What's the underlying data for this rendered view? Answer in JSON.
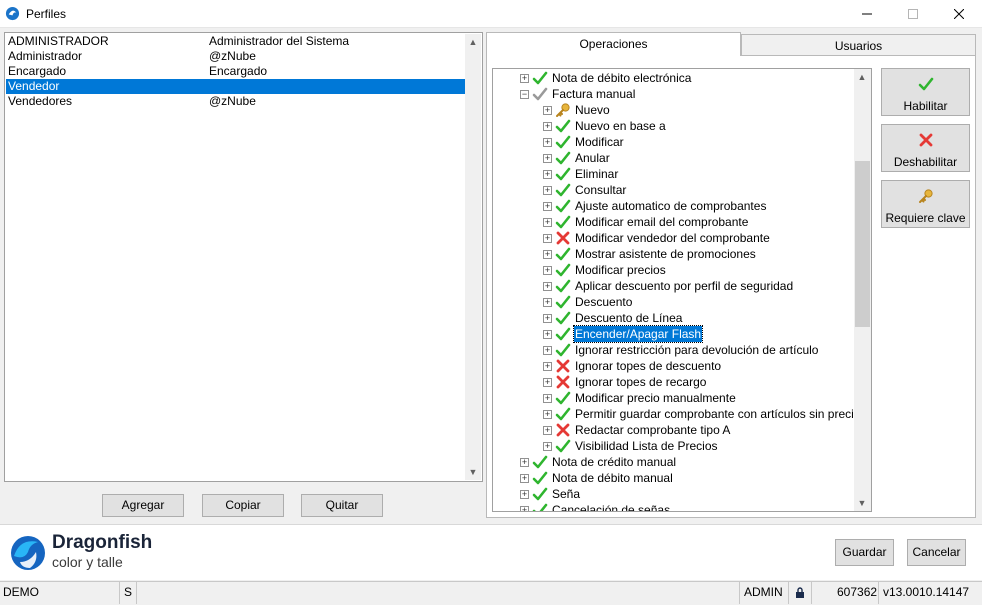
{
  "window": {
    "title": "Perfiles",
    "minimize_icon": "minimize-icon",
    "maximize_icon": "maximize-icon",
    "close_icon": "close-icon"
  },
  "profiles": [
    {
      "name": "ADMINISTRADOR",
      "description": "Administrador del Sistema"
    },
    {
      "name": "Administrador",
      "description": "@zNube"
    },
    {
      "name": "Encargado",
      "description": "Encargado"
    },
    {
      "name": "Vendedor",
      "description": "",
      "selected": true
    },
    {
      "name": "Vendedores",
      "description": "@zNube"
    }
  ],
  "left_buttons": {
    "agregar": "Agregar",
    "copiar": "Copiar",
    "quitar": "Quitar"
  },
  "tabs": [
    {
      "label": "Operaciones",
      "active": true
    },
    {
      "label": "Usuarios",
      "active": false
    }
  ],
  "tree": [
    {
      "label": "Nota de débito electrónica",
      "level": 0,
      "status": "check"
    },
    {
      "label": "Factura manual",
      "level": 0,
      "status": "partial",
      "expanded": true
    },
    {
      "label": "Nuevo",
      "level": 1,
      "status": "key"
    },
    {
      "label": "Nuevo en base a",
      "level": 1,
      "status": "check"
    },
    {
      "label": "Modificar",
      "level": 1,
      "status": "check"
    },
    {
      "label": "Anular",
      "level": 1,
      "status": "check"
    },
    {
      "label": "Eliminar",
      "level": 1,
      "status": "check"
    },
    {
      "label": "Consultar",
      "level": 1,
      "status": "check"
    },
    {
      "label": "Ajuste automatico de comprobantes",
      "level": 1,
      "status": "check"
    },
    {
      "label": "Modificar email del comprobante",
      "level": 1,
      "status": "check"
    },
    {
      "label": "Modificar vendedor del comprobante",
      "level": 1,
      "status": "cross"
    },
    {
      "label": "Mostrar asistente de promociones",
      "level": 1,
      "status": "check"
    },
    {
      "label": "Modificar precios",
      "level": 1,
      "status": "check"
    },
    {
      "label": "Aplicar descuento por perfil de seguridad",
      "level": 1,
      "status": "check"
    },
    {
      "label": "Descuento",
      "level": 1,
      "status": "check"
    },
    {
      "label": "Descuento de Línea",
      "level": 1,
      "status": "check"
    },
    {
      "label": "Encender/Apagar Flash",
      "level": 1,
      "status": "check",
      "selected": true
    },
    {
      "label": "Ignorar restricción para devolución de artículo",
      "level": 1,
      "status": "check"
    },
    {
      "label": "Ignorar topes de descuento",
      "level": 1,
      "status": "cross"
    },
    {
      "label": "Ignorar topes de recargo",
      "level": 1,
      "status": "cross"
    },
    {
      "label": "Modificar precio manualmente",
      "level": 1,
      "status": "check"
    },
    {
      "label": "Permitir guardar comprobante con artículos sin precio",
      "level": 1,
      "status": "check"
    },
    {
      "label": "Redactar comprobante tipo A",
      "level": 1,
      "status": "cross"
    },
    {
      "label": "Visibilidad Lista de Precios",
      "level": 1,
      "status": "check"
    },
    {
      "label": "Nota de crédito manual",
      "level": 0,
      "status": "check"
    },
    {
      "label": "Nota de débito manual",
      "level": 0,
      "status": "check"
    },
    {
      "label": "Seña",
      "level": 0,
      "status": "check"
    },
    {
      "label": "Cancelación de señas",
      "level": 0,
      "status": "check"
    }
  ],
  "side_buttons": {
    "habilitar": "Habilitar",
    "deshabilitar": "Deshabilitar",
    "requiere_clave": "Requiere clave"
  },
  "brand": {
    "name": "Dragonfish",
    "sub": "color y talle"
  },
  "footer_buttons": {
    "guardar": "Guardar",
    "cancelar": "Cancelar"
  },
  "status": {
    "mode": "DEMO",
    "flag": "S",
    "user": "ADMIN",
    "lock_icon": "lock-icon",
    "number": "607362",
    "version": "v13.0010.14147"
  },
  "colors": {
    "selection": "#0078d7",
    "check": "#2fb52f",
    "cross": "#e53935",
    "key": "#e7b53c",
    "partial": "#9a9a9a"
  }
}
